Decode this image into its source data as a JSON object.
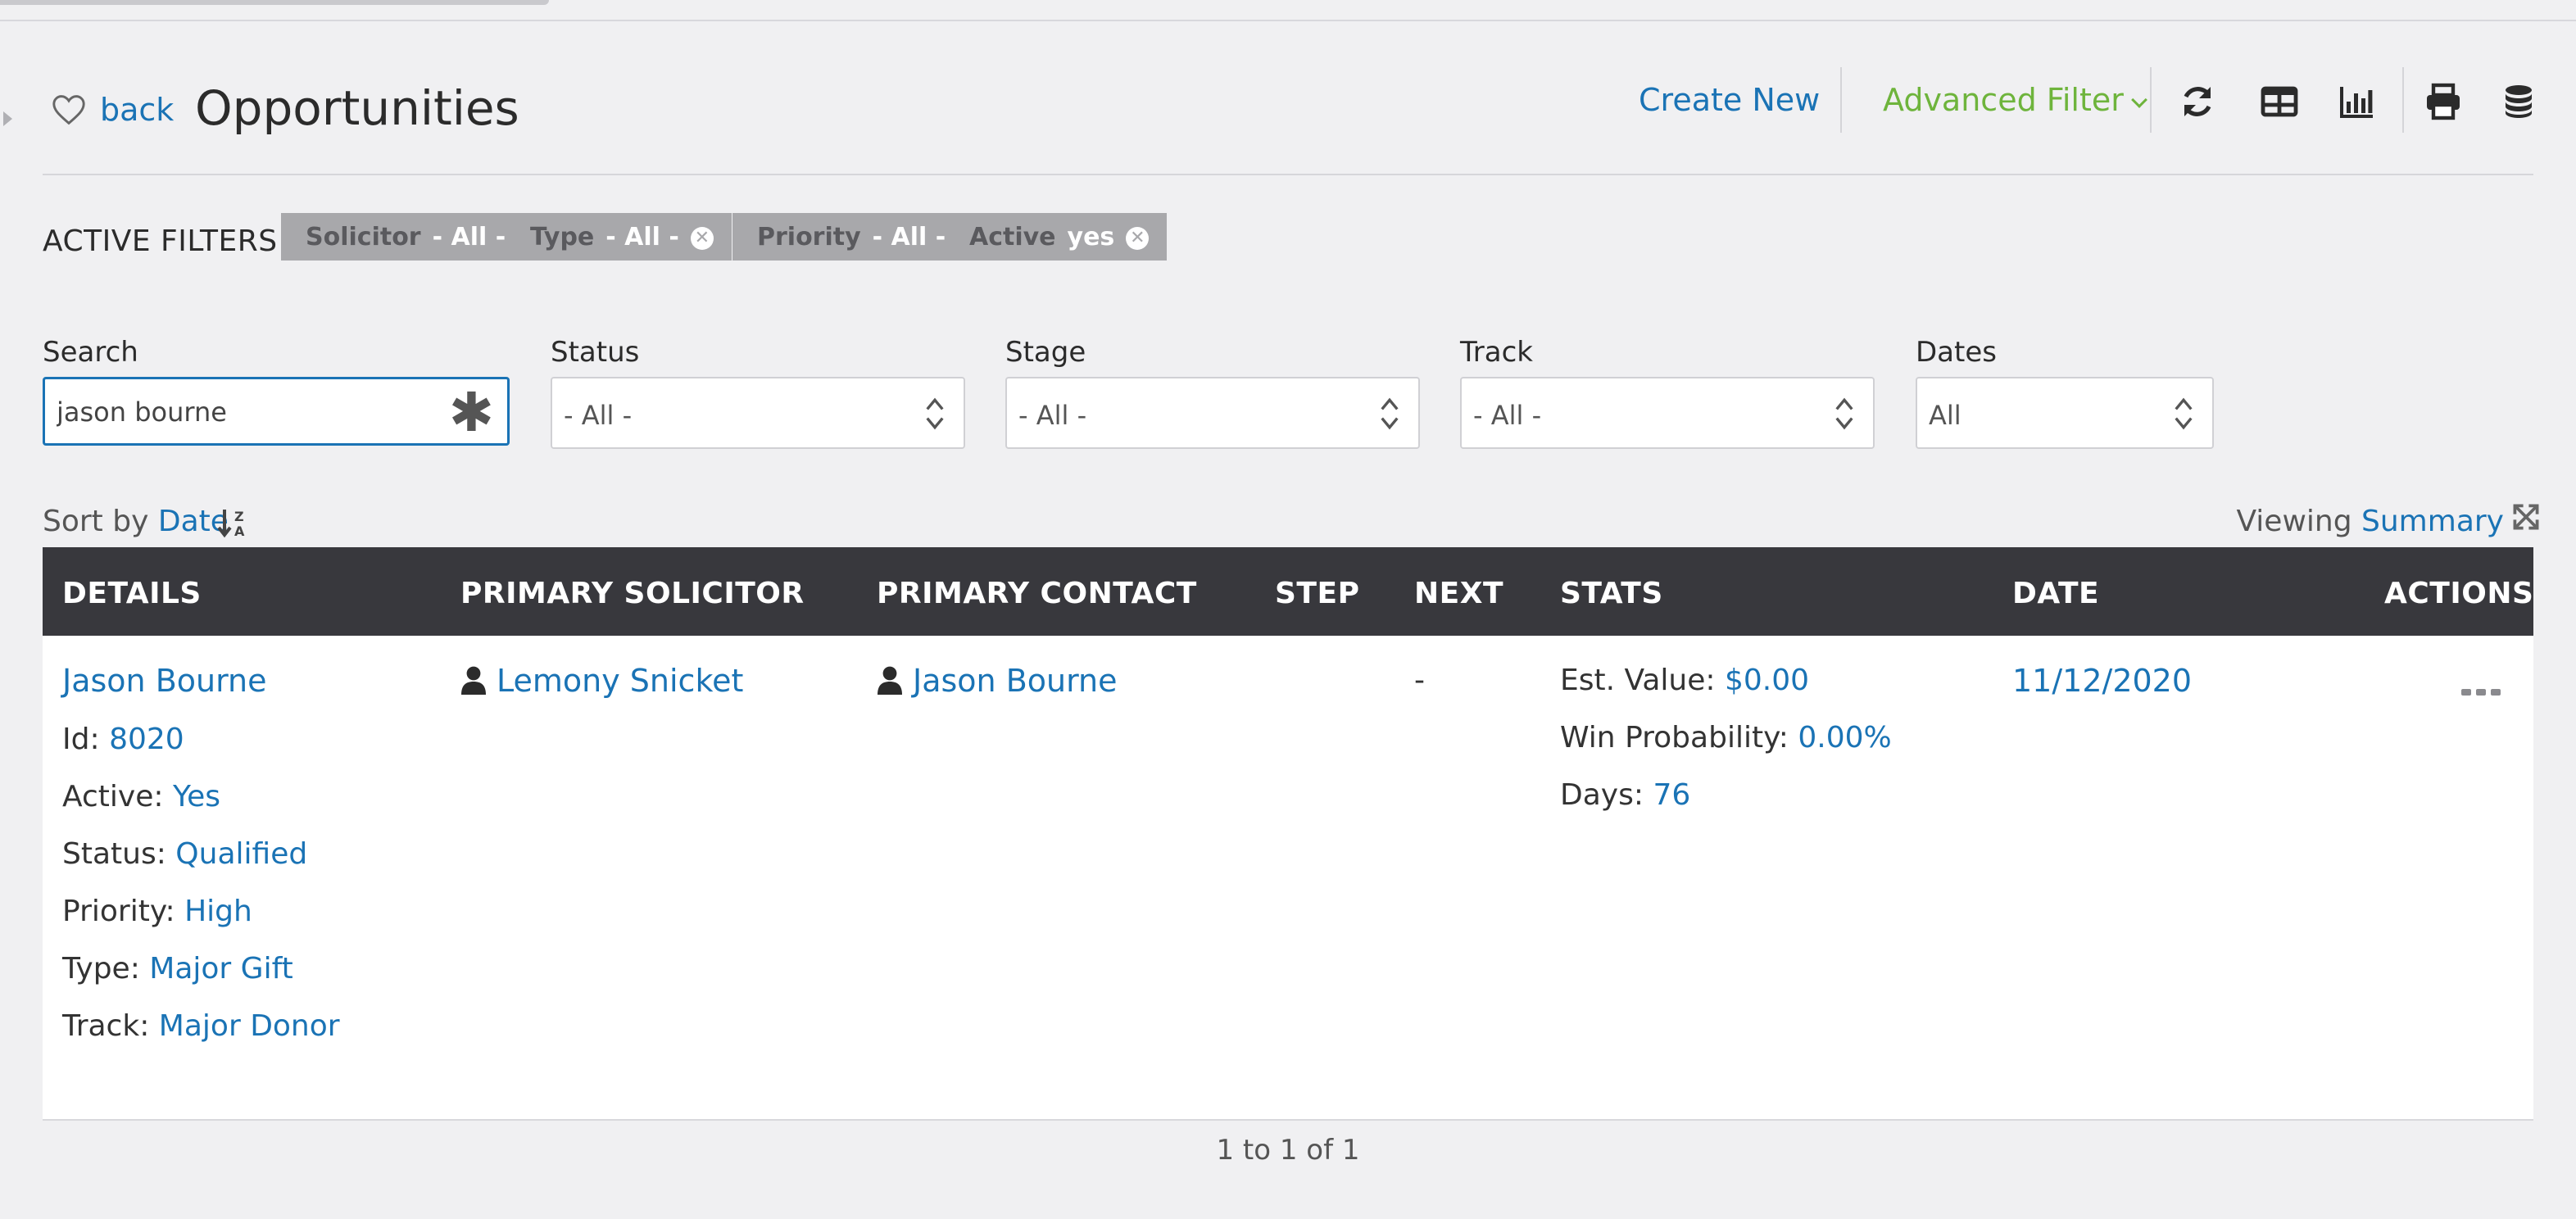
{
  "header": {
    "back_label": "back",
    "title": "Opportunities",
    "create_new": "Create New",
    "advanced_filter": "Advanced Filter"
  },
  "active_filters": {
    "label": "ACTIVE FILTERS",
    "chips": [
      {
        "name": "Solicitor",
        "value": "- All -",
        "removable": false
      },
      {
        "name": "Type",
        "value": "- All -",
        "removable": true
      },
      {
        "name": "Priority",
        "value": "- All -",
        "removable": false
      },
      {
        "name": "Active",
        "value": "yes",
        "removable": true
      }
    ]
  },
  "filters": {
    "search_label": "Search",
    "search_value": "jason bourne",
    "status_label": "Status",
    "status_value": "- All -",
    "stage_label": "Stage",
    "stage_value": "- All -",
    "track_label": "Track",
    "track_value": "- All -",
    "dates_label": "Dates",
    "dates_value": "All"
  },
  "sort": {
    "prefix": "Sort by",
    "field": "Date"
  },
  "viewing": {
    "prefix": "Viewing",
    "mode": "Summary"
  },
  "table": {
    "columns": [
      "DETAILS",
      "PRIMARY SOLICITOR",
      "PRIMARY CONTACT",
      "STEP",
      "NEXT",
      "STATS",
      "DATE",
      "ACTIONS"
    ],
    "row": {
      "name": "Jason Bourne",
      "details": [
        {
          "label": "Id:",
          "value": "8020"
        },
        {
          "label": "Active:",
          "value": "Yes"
        },
        {
          "label": "Status:",
          "value": "Qualified"
        },
        {
          "label": "Priority:",
          "value": "High"
        },
        {
          "label": "Type:",
          "value": "Major Gift"
        },
        {
          "label": "Track:",
          "value": "Major Donor"
        }
      ],
      "solicitor": "Lemony Snicket",
      "contact": "Jason Bourne",
      "next": "-",
      "stats": [
        {
          "label": "Est. Value:",
          "value": "$0.00"
        },
        {
          "label": "Win Probability:",
          "value": "0.00%"
        },
        {
          "label": "Days:",
          "value": "76"
        }
      ],
      "date": "11/12/2020"
    }
  },
  "pager": "1 to 1 of 1",
  "colors": {
    "link": "#1a73b5",
    "green": "#6eb43c",
    "header_bg": "#38383d",
    "chip_bg": "#a8a8ab"
  },
  "icons": [
    "heart-icon",
    "refresh-icon",
    "table-icon",
    "bar-chart-icon",
    "print-icon",
    "database-icon",
    "sort-icon",
    "expand-icon",
    "user-icon",
    "more-icon"
  ]
}
